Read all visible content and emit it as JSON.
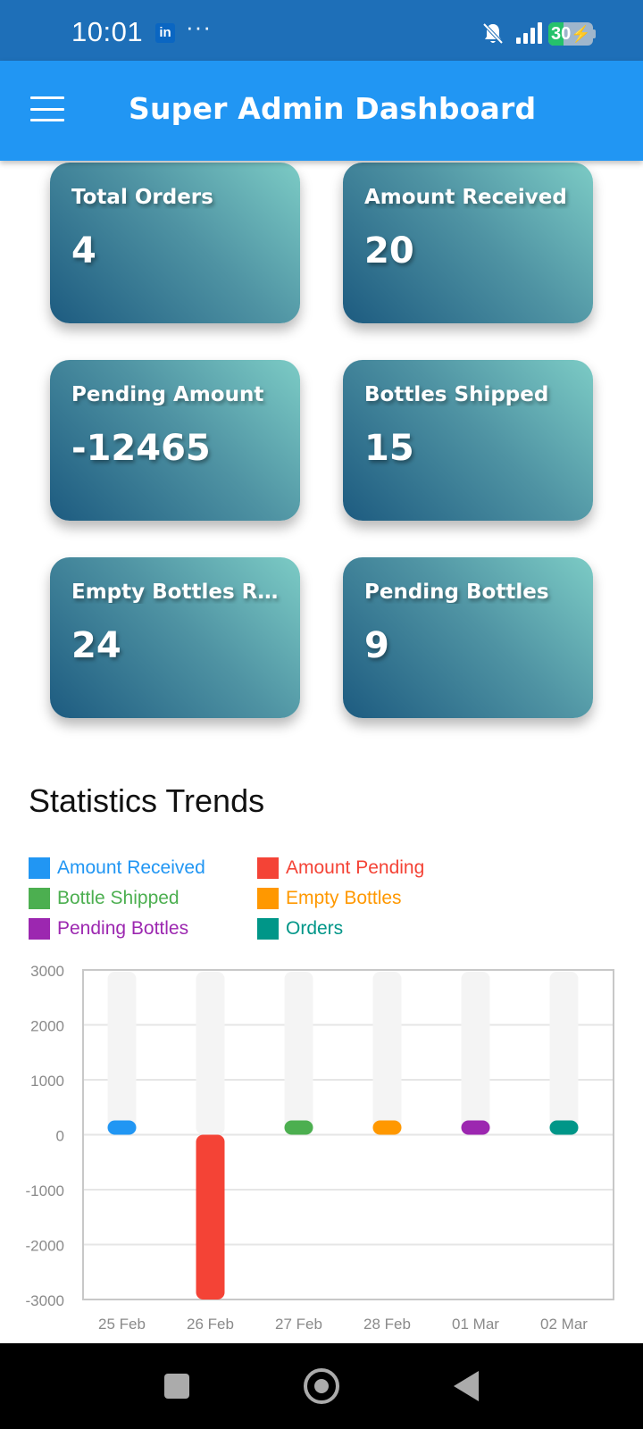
{
  "status_bar": {
    "time": "10:01",
    "linkedin_label": "in",
    "more_dots": "···",
    "battery_level": "30",
    "icons": [
      "linkedin-icon",
      "bell-off-icon",
      "signal-icon",
      "wifi-icon",
      "battery-charging-icon"
    ]
  },
  "app_bar": {
    "title": "Super Admin Dashboard",
    "menu_icon": "hamburger-menu-icon"
  },
  "cards": [
    {
      "label": "Total Orders",
      "value": "4"
    },
    {
      "label": "Amount Received",
      "value": "20"
    },
    {
      "label": "Pending Amount",
      "value": "-12465"
    },
    {
      "label": "Bottles Shipped",
      "value": "15"
    },
    {
      "label": "Empty Bottles Re...",
      "value": "24"
    },
    {
      "label": "Pending Bottles",
      "value": "9"
    }
  ],
  "stats": {
    "title": "Statistics Trends",
    "legend": [
      {
        "name": "Amount Received",
        "color": "#2196f3"
      },
      {
        "name": "Amount Pending",
        "color": "#f44336"
      },
      {
        "name": "Bottle Shipped",
        "color": "#4caf50"
      },
      {
        "name": "Empty Bottles",
        "color": "#ff9800"
      },
      {
        "name": "Pending Bottles",
        "color": "#9c27b0"
      },
      {
        "name": "Orders",
        "color": "#009688"
      }
    ]
  },
  "chart_data": {
    "type": "bar",
    "categories": [
      "25 Feb",
      "26 Feb",
      "27 Feb",
      "28 Feb",
      "01 Mar",
      "02 Mar"
    ],
    "yticks": [
      "3000",
      "2000",
      "1000",
      "0",
      "-1000",
      "-2000",
      "-3000"
    ],
    "ylim": [
      -3000,
      3000
    ],
    "grid": true,
    "background_bar_color": "#f4f4f4",
    "bars": [
      {
        "category": "25 Feb",
        "series": "Amount Received",
        "value": 20,
        "color": "#2196f3"
      },
      {
        "category": "26 Feb",
        "series": "Amount Pending",
        "value": -3000,
        "color": "#f44336"
      },
      {
        "category": "27 Feb",
        "series": "Bottle Shipped",
        "value": 15,
        "color": "#4caf50"
      },
      {
        "category": "28 Feb",
        "series": "Empty Bottles",
        "value": 24,
        "color": "#ff9800"
      },
      {
        "category": "01 Mar",
        "series": "Pending Bottles",
        "value": 9,
        "color": "#9c27b0"
      },
      {
        "category": "02 Mar",
        "series": "Orders",
        "value": 4,
        "color": "#009688"
      }
    ]
  },
  "nav_bar": {
    "icons": [
      "recents-square-icon",
      "home-circle-icon",
      "back-triangle-icon"
    ]
  }
}
